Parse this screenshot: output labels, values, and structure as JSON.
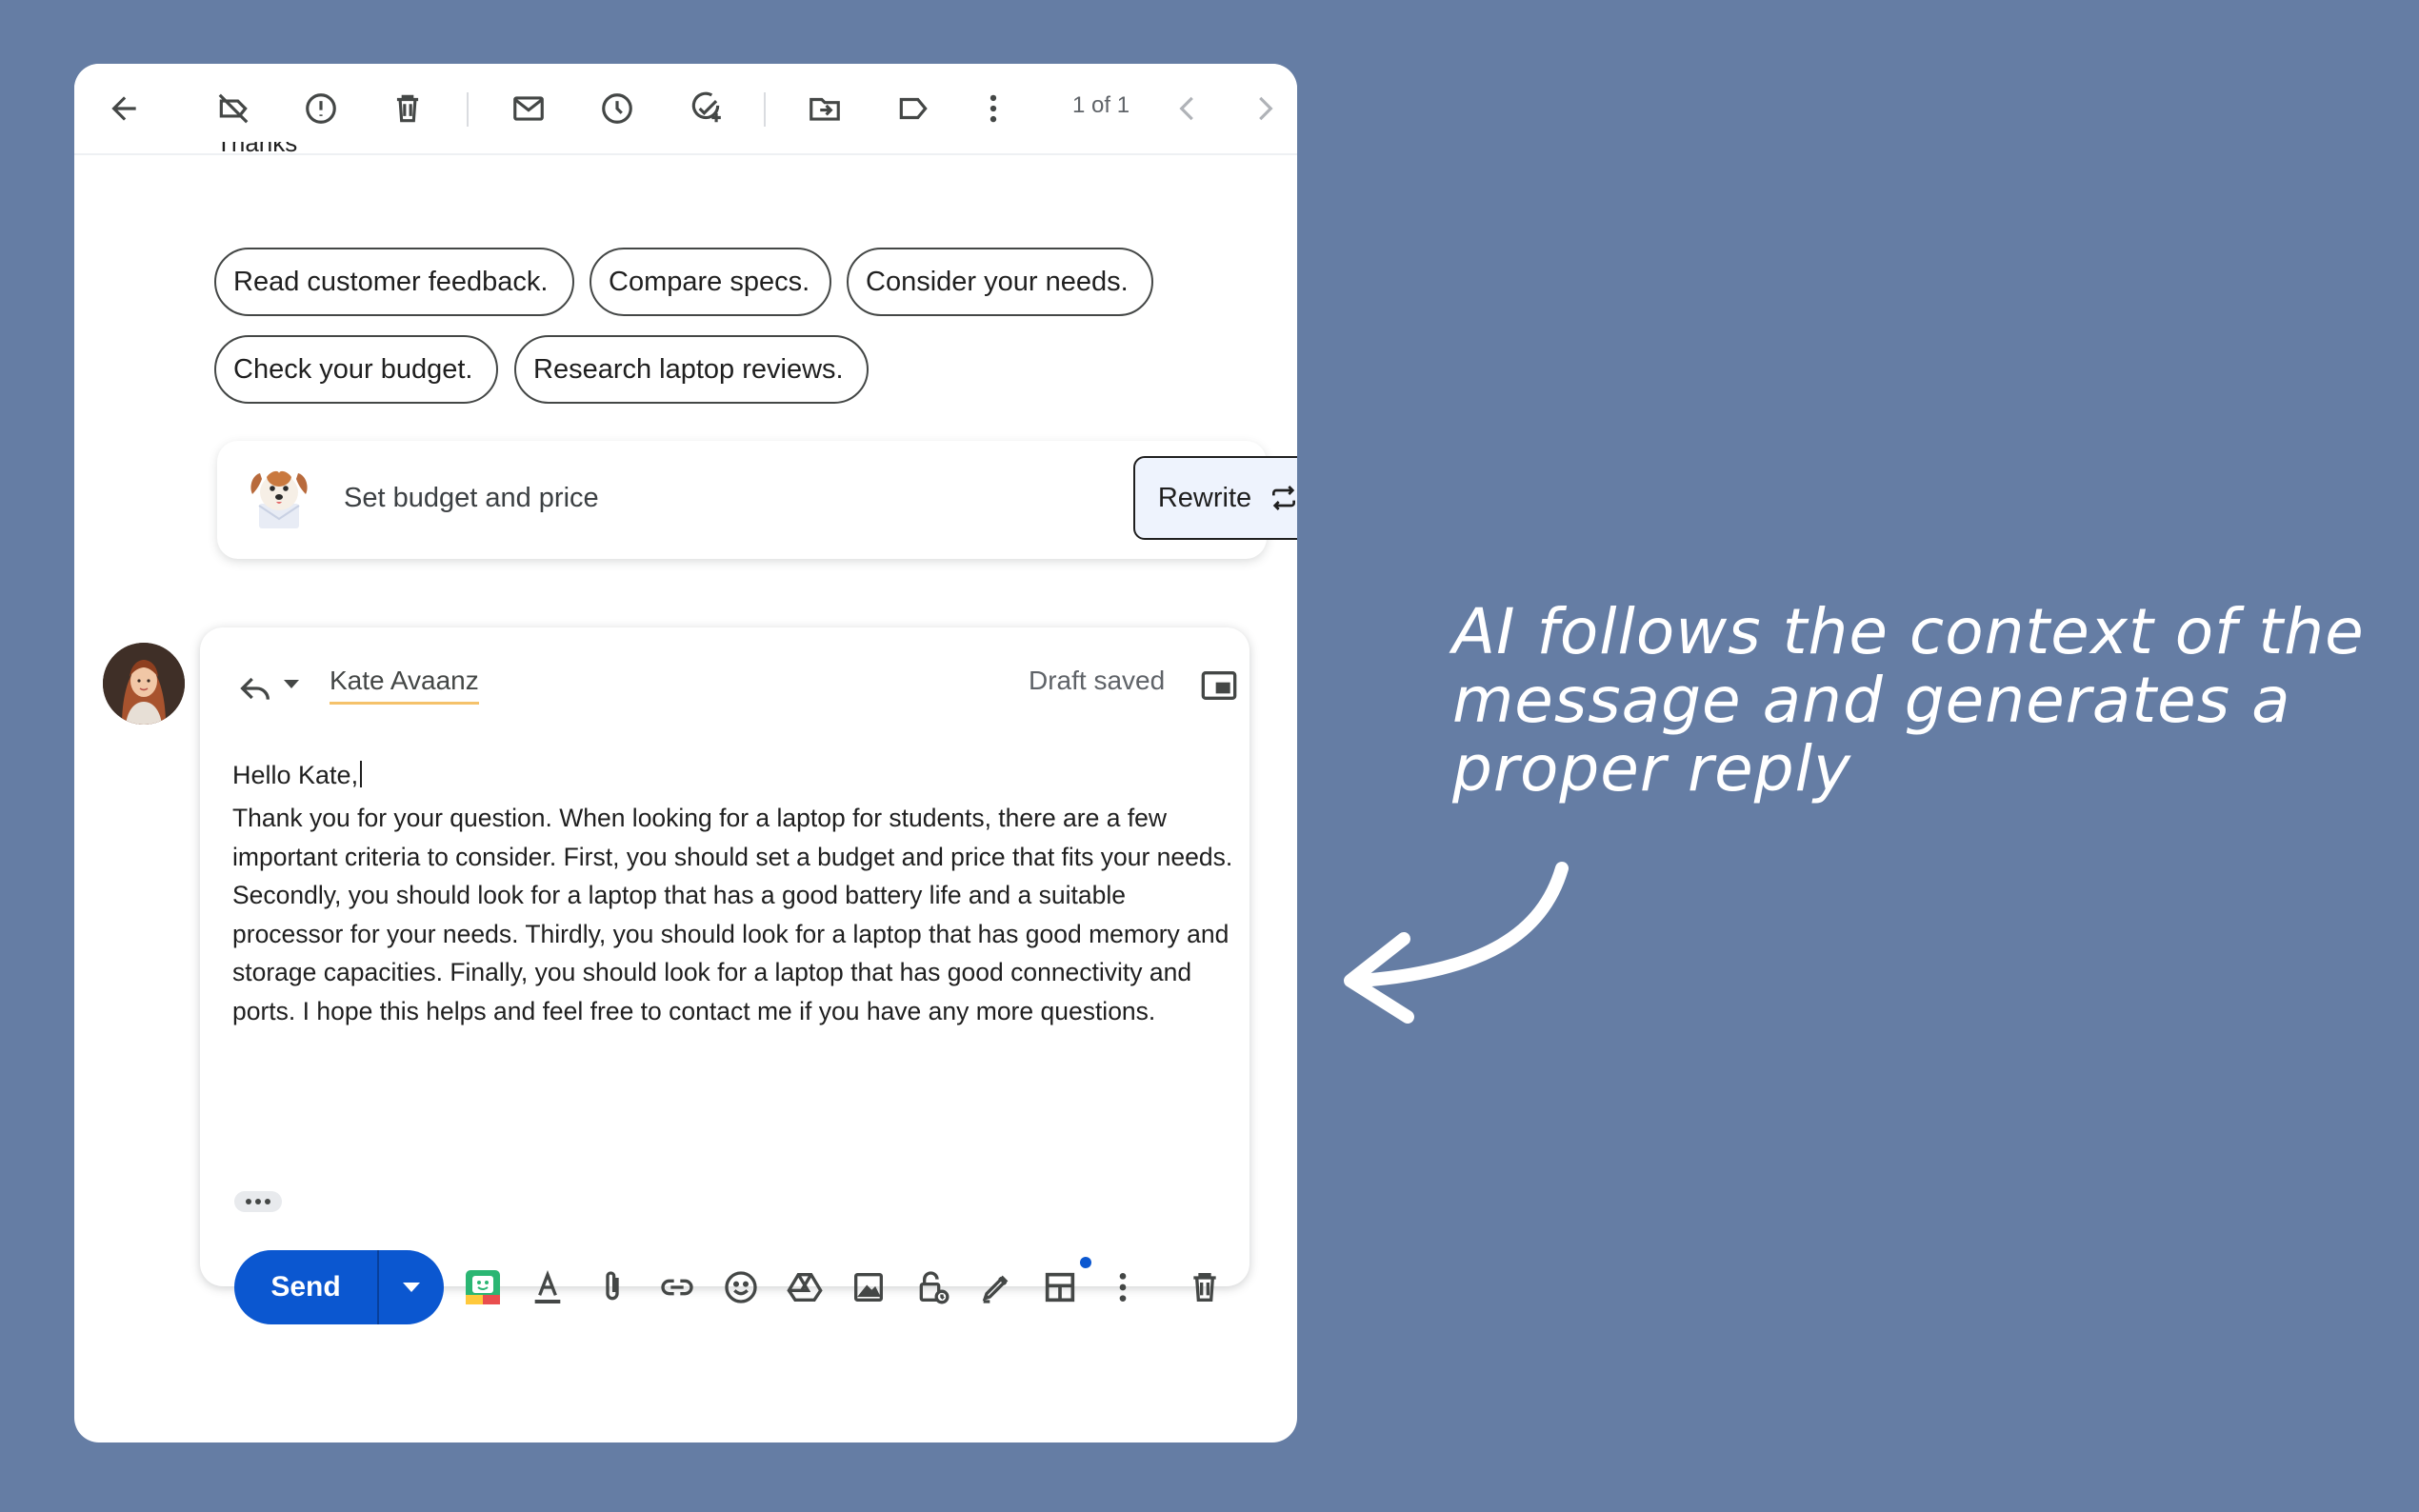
{
  "toolbar": {
    "icons": [
      "back-arrow-icon",
      "no-snooze-icon",
      "report-spam-icon",
      "delete-icon",
      "mark-unread-icon",
      "snooze-icon",
      "add-task-icon",
      "move-to-icon",
      "label-icon",
      "more-vert-icon",
      "prev-icon",
      "next-icon"
    ],
    "pager": "1 of 1"
  },
  "thread": {
    "previous_text_fragment": "Thanks"
  },
  "smart_replies": [
    "Read customer feedback.",
    "Compare specs.",
    "Consider your needs.",
    "Check your budget.",
    "Research laptop reviews."
  ],
  "suggestion": {
    "text": "Set budget and price",
    "rewrite_label": "Rewrite"
  },
  "compose": {
    "recipient": "Kate Avaanz",
    "status": "Draft saved",
    "greeting": "Hello Kate,",
    "body": "Thank you for your question. When looking for a laptop for students, there are a few important criteria to consider. First, you should set a budget and price that fits your needs. Secondly, you should look for a laptop that has a good battery life and a suitable processor for your needs. Thirdly, you should look for a laptop that has good memory and storage capacities. Finally, you should look for a laptop that has good connectivity and ports. I hope this helps and feel free to contact me if you have any more questions.",
    "send_label": "Send",
    "footer_icons": [
      "extension-icon",
      "text-format-icon",
      "attach-icon",
      "link-icon",
      "emoji-icon",
      "drive-icon",
      "image-icon",
      "confidential-lock-icon",
      "signature-pen-icon",
      "layout-template-icon",
      "more-options-icon",
      "discard-icon"
    ]
  },
  "caption": {
    "text": "AI follows the context of the message and generates a proper reply"
  },
  "colors": {
    "background": "#657da4",
    "send_button": "#0b57d0",
    "recipient_underline": "#f5c26b",
    "rewrite_bg": "#eef3fd"
  }
}
